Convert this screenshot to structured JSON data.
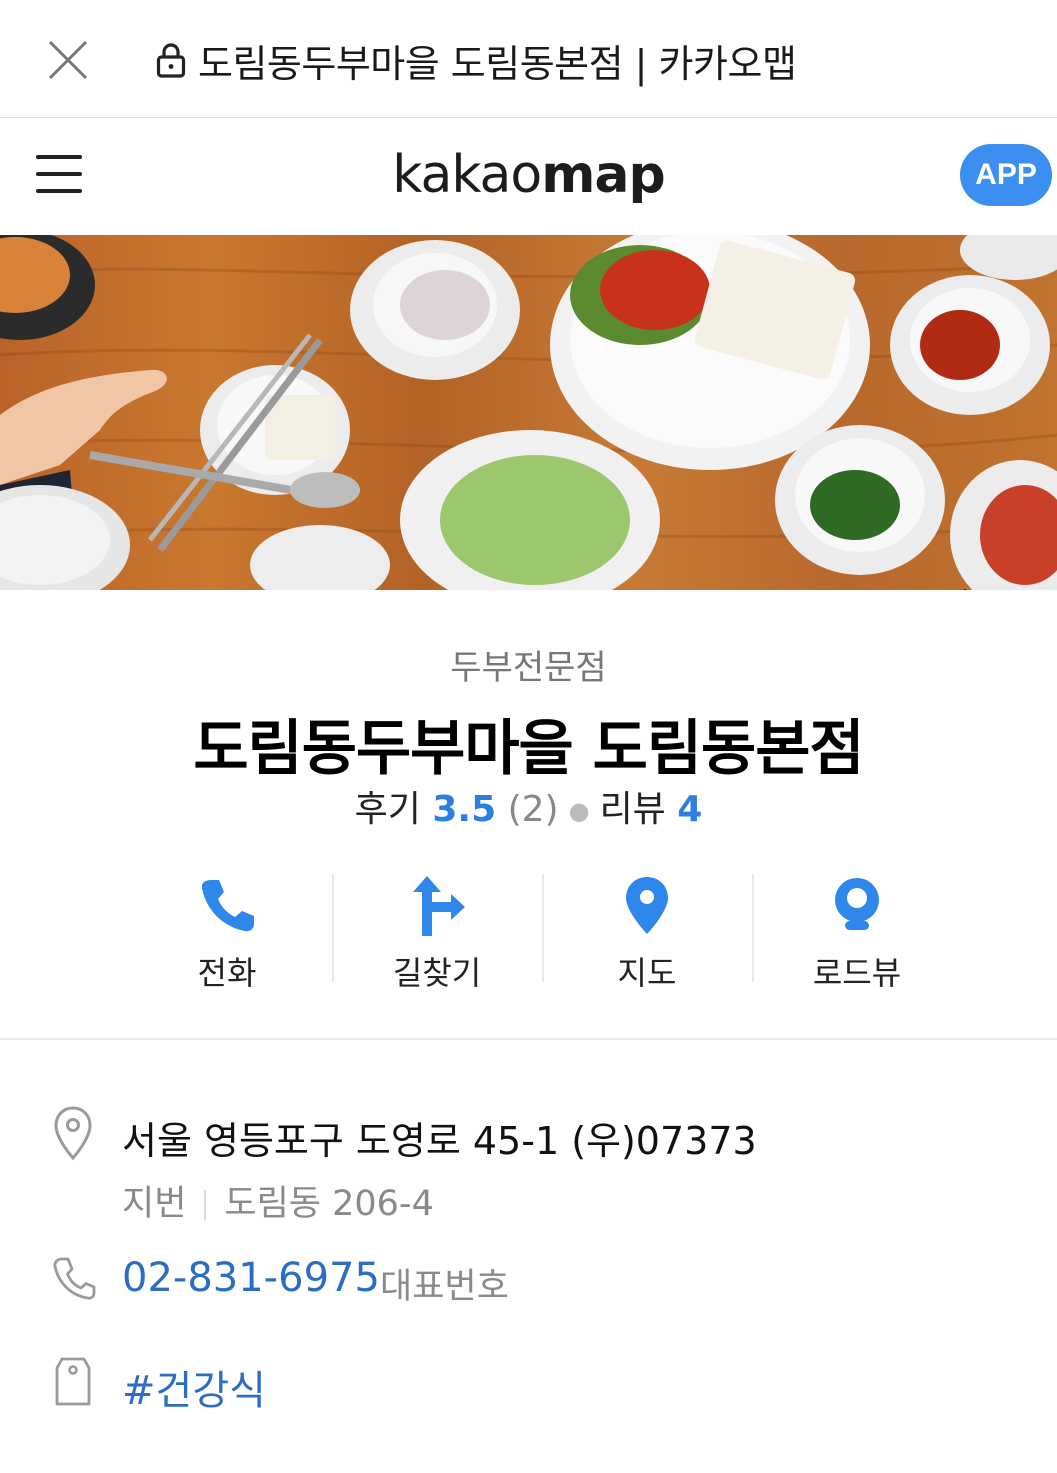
{
  "browser": {
    "title": "도림동두부마을 도림동본점 | 카카오맵"
  },
  "header": {
    "logo_light": "kakao",
    "logo_bold": "map",
    "app_button": "APP"
  },
  "place": {
    "category": "두부전문점",
    "name": "도림동두부마을 도림동본점",
    "review_label": "후기",
    "review_score": "3.5",
    "review_count": "(2)",
    "blog_label": "리뷰",
    "blog_count": "4"
  },
  "actions": [
    {
      "label": "전화",
      "icon": "phone-icon"
    },
    {
      "label": "길찾기",
      "icon": "directions-icon"
    },
    {
      "label": "지도",
      "icon": "map-pin-icon"
    },
    {
      "label": "로드뷰",
      "icon": "roadview-icon"
    }
  ],
  "info": {
    "address": "서울 영등포구 도영로 45-1 (우)07373",
    "jibun_label": "지번",
    "jibun_value": "도림동 206-4",
    "phone": "02-831-6975",
    "phone_tag": "대표번호",
    "hashtag": "#건강식"
  },
  "colors": {
    "accent_blue": "#3c8ff0",
    "link_blue": "#2b6cc4",
    "score_blue": "#2b7fe0"
  }
}
